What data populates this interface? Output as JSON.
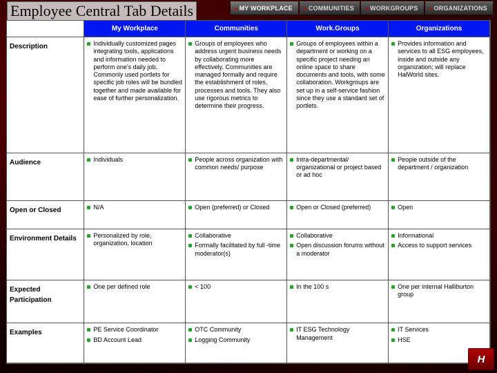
{
  "title": "Employee Central Tab Details",
  "topnav": {
    "items": [
      {
        "label": "MY WORKPLACE",
        "selected": true
      },
      {
        "label": "COMMUNITIES",
        "selected": false
      },
      {
        "label": "WORKGROUPS",
        "selected": false
      },
      {
        "label": "ORGANIZATIONS",
        "selected": false
      }
    ]
  },
  "columns": [
    "My Workplace",
    "Communities",
    "Work.Groups",
    "Organizations"
  ],
  "rows": [
    {
      "label": "Description",
      "cells": [
        [
          "Individually customized pages integrating tools, applications and information needed to perform one's daily job. Commonly used portlets for specific job roles will be bundled together and made available for ease of further personalization."
        ],
        [
          "Groups of employees who address urgent business needs by collaborating more effectively. Communities are managed formally and require the establishment of roles, processes and tools. They also use rigorous metrics to determine their progress."
        ],
        [
          "Groups of employees within a department or working on a specific project needing an online space to share documents and tools, with some collaboration. Workgroups are set up in a self-service fashion since they use a standard set of portlets."
        ],
        [
          "Provides information and services to all ESG employees, inside and outside any organization; will replace HalWorld sites."
        ]
      ]
    },
    {
      "label": "Audience",
      "cells": [
        [
          "Individuals"
        ],
        [
          "People across organization with common needs/ purpose"
        ],
        [
          "Intra-departmental/ organizational or project based or ad hoc"
        ],
        [
          "People outside of the department / organization"
        ]
      ]
    },
    {
      "label": "Open or Closed",
      "cells": [
        [
          "N/A"
        ],
        [
          "Open (preferred) or Closed"
        ],
        [
          "Open or Closed (preferred)"
        ],
        [
          "Open"
        ]
      ]
    },
    {
      "label": "Environment Details",
      "cells": [
        [
          "Personalized by role, organization, location"
        ],
        [
          "Collaborative",
          "Formally facilitated by full -time moderator(s)"
        ],
        [
          "Collaborative",
          "Open discussion forums without a moderator"
        ],
        [
          "Informational",
          "Access to support services"
        ]
      ]
    },
    {
      "label": "Expected Participation",
      "cells": [
        [
          "One per defined role"
        ],
        [
          "< 100"
        ],
        [
          "In the 100 s"
        ],
        [
          "One per internal Halliburton group"
        ]
      ]
    },
    {
      "label": "Examples",
      "cells": [
        [
          "PE Service Coordinator",
          "BD Account Lead"
        ],
        [
          "OTC Community",
          "Logging Community"
        ],
        [
          "IT ESG Technology Management"
        ],
        [
          "IT Services",
          "HSE"
        ]
      ]
    }
  ],
  "logo": "H"
}
